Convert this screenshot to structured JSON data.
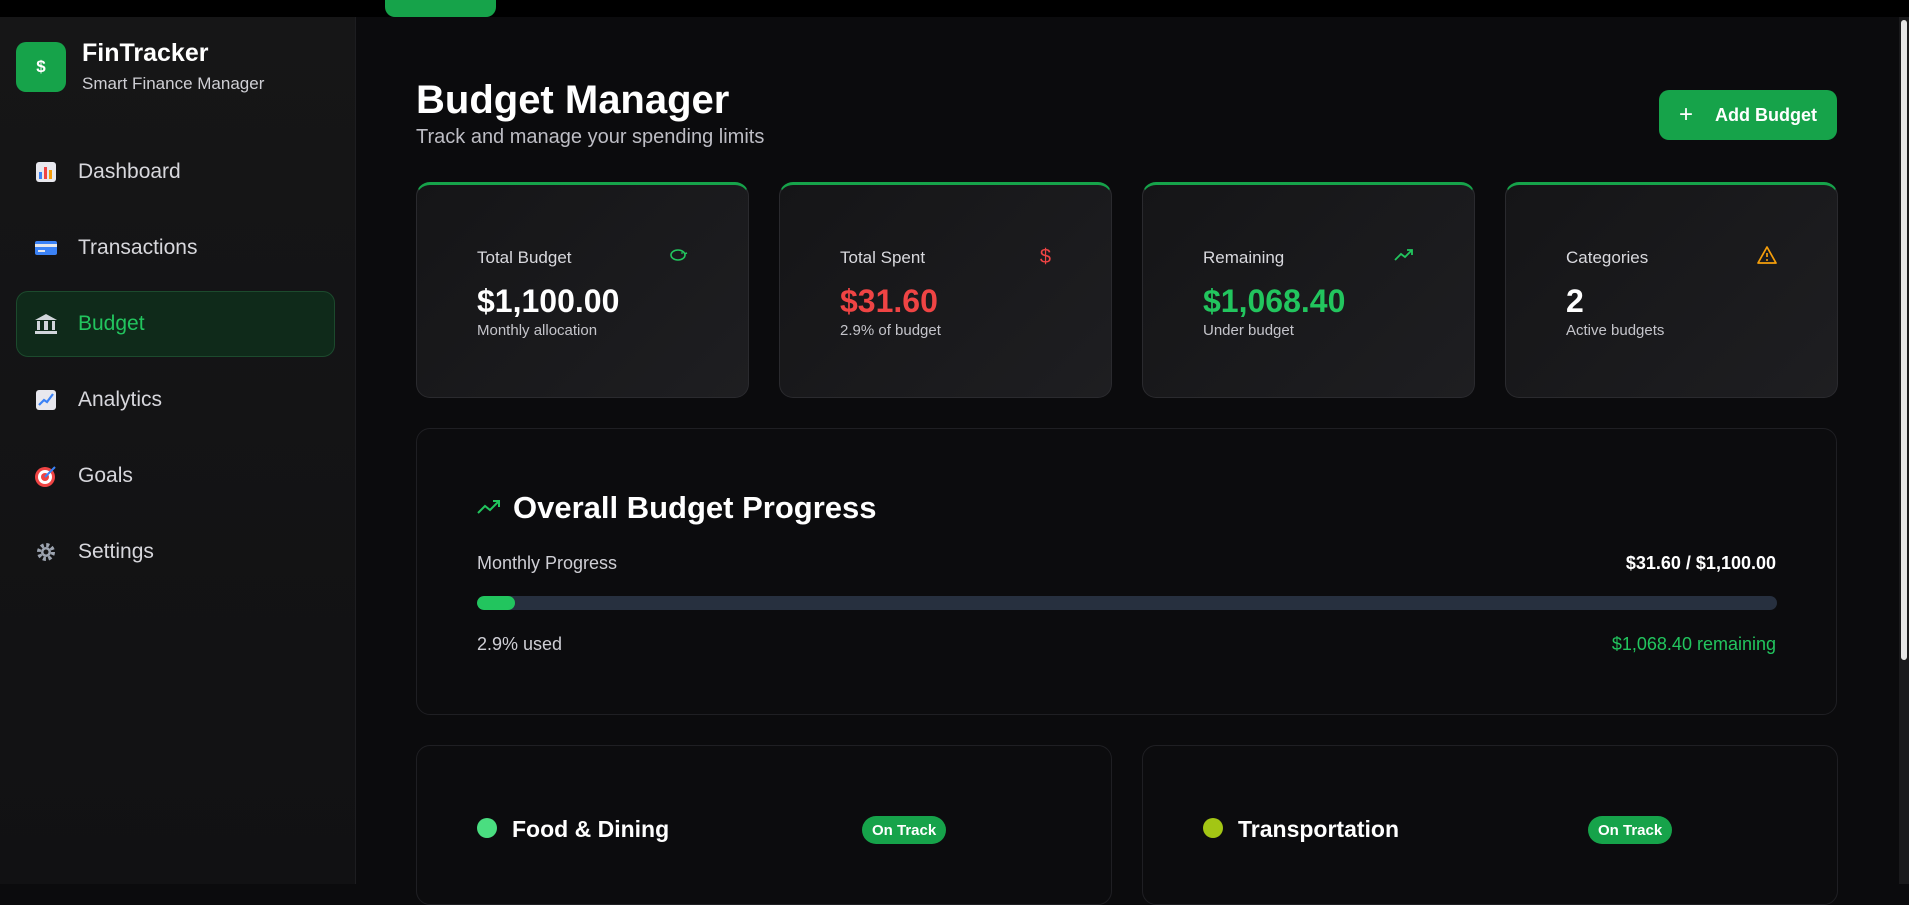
{
  "sidebar": {
    "brand_logo": "$",
    "brand_title": "FinTracker",
    "brand_subtitle": "Smart Finance Manager",
    "items": [
      {
        "label": "Dashboard",
        "icon": "bar-chart-icon"
      },
      {
        "label": "Transactions",
        "icon": "credit-card-icon"
      },
      {
        "label": "Budget",
        "icon": "bank-icon",
        "active": true
      },
      {
        "label": "Analytics",
        "icon": "line-chart-icon"
      },
      {
        "label": "Goals",
        "icon": "target-icon"
      },
      {
        "label": "Settings",
        "icon": "gear-icon"
      }
    ]
  },
  "header": {
    "title": "Budget Manager",
    "subtitle": "Track and manage your spending limits",
    "add_button_label": "Add Budget"
  },
  "stats": [
    {
      "label": "Total Budget",
      "value": "$1,100.00",
      "sub": "Monthly allocation",
      "icon": "piggy-bank-icon",
      "value_color": "#ffffff",
      "icon_color": "#22c55e"
    },
    {
      "label": "Total Spent",
      "value": "$31.60",
      "sub": "2.9% of budget",
      "icon": "dollar-icon",
      "value_color": "#ef4444",
      "icon_color": "#ef4444"
    },
    {
      "label": "Remaining",
      "value": "$1,068.40",
      "sub": "Under budget",
      "icon": "trending-up-icon",
      "value_color": "#22c55e",
      "icon_color": "#22c55e"
    },
    {
      "label": "Categories",
      "value": "2",
      "sub": "Active budgets",
      "icon": "alert-triangle-icon",
      "value_color": "#ffffff",
      "icon_color": "#f59e0b"
    }
  ],
  "progress": {
    "title": "Overall Budget Progress",
    "label": "Monthly Progress",
    "amount": "$31.60 / $1,100.00",
    "percent_used": 2.9,
    "used_text": "2.9% used",
    "remaining_text": "$1,068.40 remaining"
  },
  "categories": [
    {
      "name": "Food & Dining",
      "badge": "On Track",
      "dot_color": "#4ade80"
    },
    {
      "name": "Transportation",
      "badge": "On Track",
      "dot_color": "#a3c614"
    }
  ],
  "colors": {
    "accent": "#16a34a",
    "danger": "#ef4444",
    "warning": "#f59e0b"
  }
}
